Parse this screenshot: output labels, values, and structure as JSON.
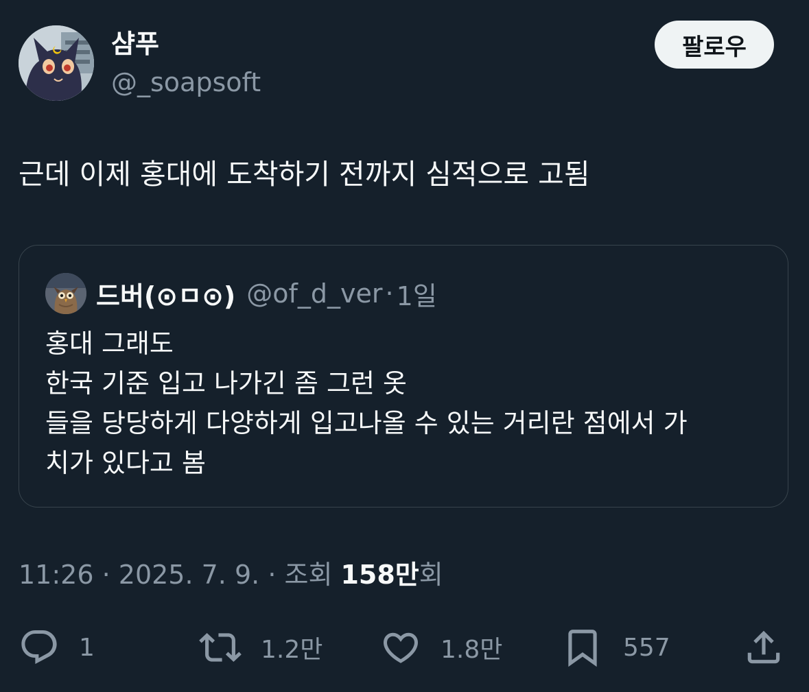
{
  "author": {
    "display_name": "샴푸",
    "handle": "@_soapsoft",
    "avatar_icon": "black-cat-avatar-icon"
  },
  "follow_label": "팔로우",
  "tweet": {
    "text": "근데 이제 홍대에 도착하기 전까지 심적으로 고됨"
  },
  "quote": {
    "display_name": "드버(⊙ㅁ⊙)",
    "handle": "@of_d_ver",
    "separator": "·",
    "time": "1일",
    "avatar_icon": "owl-avatar-icon",
    "lines": [
      "홍대 그래도",
      "한국 기준 입고 나가긴 좀 그런 옷",
      "들을 당당하게 다양하게 입고나올 수 있는 거리란 점에서 가",
      "치가 있다고 봄"
    ]
  },
  "meta": {
    "time": "11:26",
    "sep1": " · ",
    "date": "2025. 7. 9.",
    "sep2": " · ",
    "views_prefix": "조회 ",
    "views_count": "158만",
    "views_suffix": "회"
  },
  "actions": {
    "reply_count": "1",
    "retweet_count": "1.2만",
    "like_count": "1.8만",
    "bookmark_count": "557"
  },
  "colors": {
    "background": "#15202b",
    "text_primary": "#f7f9f9",
    "text_secondary": "#8b98a5",
    "border": "#38444d",
    "follow_button_bg": "#eff3f4"
  }
}
